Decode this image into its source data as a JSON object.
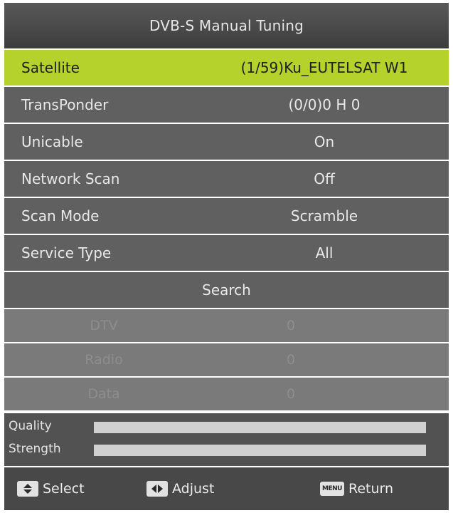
{
  "title": "DVB-S Manual Tuning",
  "settings": [
    {
      "label": "Satellite",
      "value": "(1/59)Ku_EUTELSAT W1"
    },
    {
      "label": "TransPonder",
      "value": "(0/0)0 H 0"
    },
    {
      "label": "Unicable",
      "value": "On"
    },
    {
      "label": "Network Scan",
      "value": "Off"
    },
    {
      "label": "Scan Mode",
      "value": "Scramble"
    },
    {
      "label": "Service Type",
      "value": "All"
    }
  ],
  "search_label": "Search",
  "results": [
    {
      "label": "DTV",
      "value": "0"
    },
    {
      "label": "Radio",
      "value": "0"
    },
    {
      "label": "Data",
      "value": "0"
    }
  ],
  "signal": {
    "quality_label": "Quality",
    "quality_level": 1.0,
    "strength_label": "Strength",
    "strength_level": 1.0
  },
  "footer": {
    "select_label": "Select",
    "adjust_label": "Adjust",
    "menu_key_text": "MENU",
    "return_label": "Return"
  },
  "colors": {
    "highlight": "#b4d12c",
    "row_bg": "#606060",
    "title_bg": "#4a4a4a"
  },
  "icons": [
    "up-down-arrows-icon",
    "left-right-arrows-icon",
    "menu-key-icon"
  ]
}
